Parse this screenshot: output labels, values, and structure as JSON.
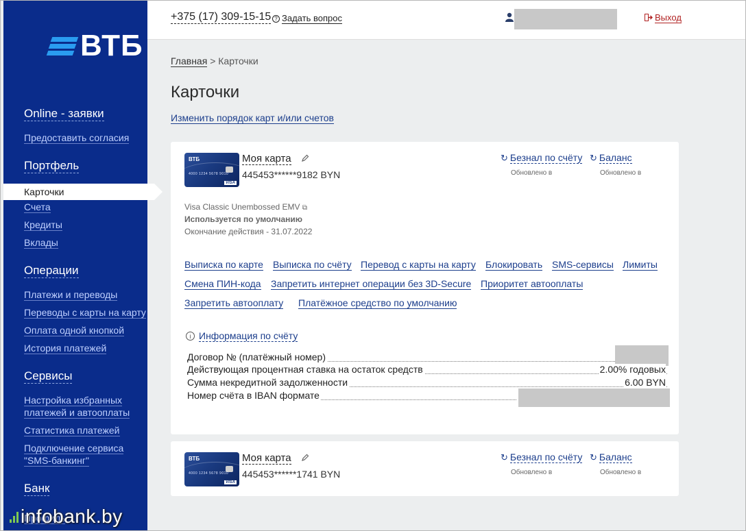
{
  "sidebar": {
    "logo": "ВТБ",
    "sections": [
      {
        "title": "Online - заявки",
        "items": [
          "Предоставить согласия"
        ]
      },
      {
        "title": "Портфель",
        "items": [
          "Карточки",
          "Счета",
          "Кредиты",
          "Вклады"
        ]
      },
      {
        "title": "Операции",
        "items": [
          "Платежи и переводы",
          "Переводы с карты на карту",
          "Оплата одной кнопкой",
          "История платежей"
        ]
      },
      {
        "title": "Сервисы",
        "items": [
          "Настройка избранных платежей и автооплаты",
          "Статистика платежей",
          "Подключение сервиса \"SMS-банкинг\""
        ]
      },
      {
        "title": "Банк",
        "items": [
          "Профиль"
        ]
      }
    ],
    "active_item": "Карточки",
    "watermark": "infobank.by"
  },
  "header": {
    "phone": "+375 (17) 309-15-15",
    "ask_question": "Задать вопрос",
    "logout": "Выход"
  },
  "breadcrumb": {
    "home": "Главная",
    "separator": ">",
    "current": "Карточки"
  },
  "page_title": "Карточки",
  "reorder_link": "Изменить порядок карт и/или счетов",
  "cards": [
    {
      "name": "Моя карта",
      "number": "445453******9182 BYN",
      "refresh_cashless": "Безнал по счёту",
      "refresh_balance": "Баланс",
      "updated_label_1": "Обновлено в",
      "updated_label_2": "Обновлено в",
      "type": "Visa Classic Unembossed EMV",
      "default_status": "Используется по умолчанию",
      "expiry": "Окончание действия - 31.07.2022",
      "actions": [
        "Выписка по карте",
        "Выписка по счёту",
        "Перевод с карты на карту",
        "Блокировать",
        "SMS-сервисы",
        "Лимиты",
        "Смена ПИН-кода",
        "Запретить интернет операции без 3D-Secure",
        "Приоритет автооплаты",
        "Запретить автооплату",
        "Платёжное средство по умолчанию"
      ],
      "info_link": "Информация по счёту",
      "info_rows": [
        {
          "label": "Договор № (платёжный номер)",
          "value": ""
        },
        {
          "label": "Действующая процентная ставка на остаток средств",
          "value": "2.00% годовых"
        },
        {
          "label": "Сумма некредитной задолженности",
          "value": "6.00 BYN"
        },
        {
          "label": "Номер счёта в IBAN формате",
          "value": ""
        }
      ]
    },
    {
      "name": "Моя карта",
      "number": "445453******1741 BYN",
      "refresh_cashless": "Безнал по счёту",
      "refresh_balance": "Баланс",
      "updated_label_1": "Обновлено в",
      "updated_label_2": "Обновлено в"
    }
  ],
  "card_image": {
    "brand": "ВТБ",
    "digits": "4000 1234 5678 9010",
    "network": "VISA"
  },
  "colors": {
    "sidebar": "#0a2c8b",
    "link": "#1c3e8c",
    "logo_accent": "#2a9cf0",
    "logout": "#b02020"
  }
}
